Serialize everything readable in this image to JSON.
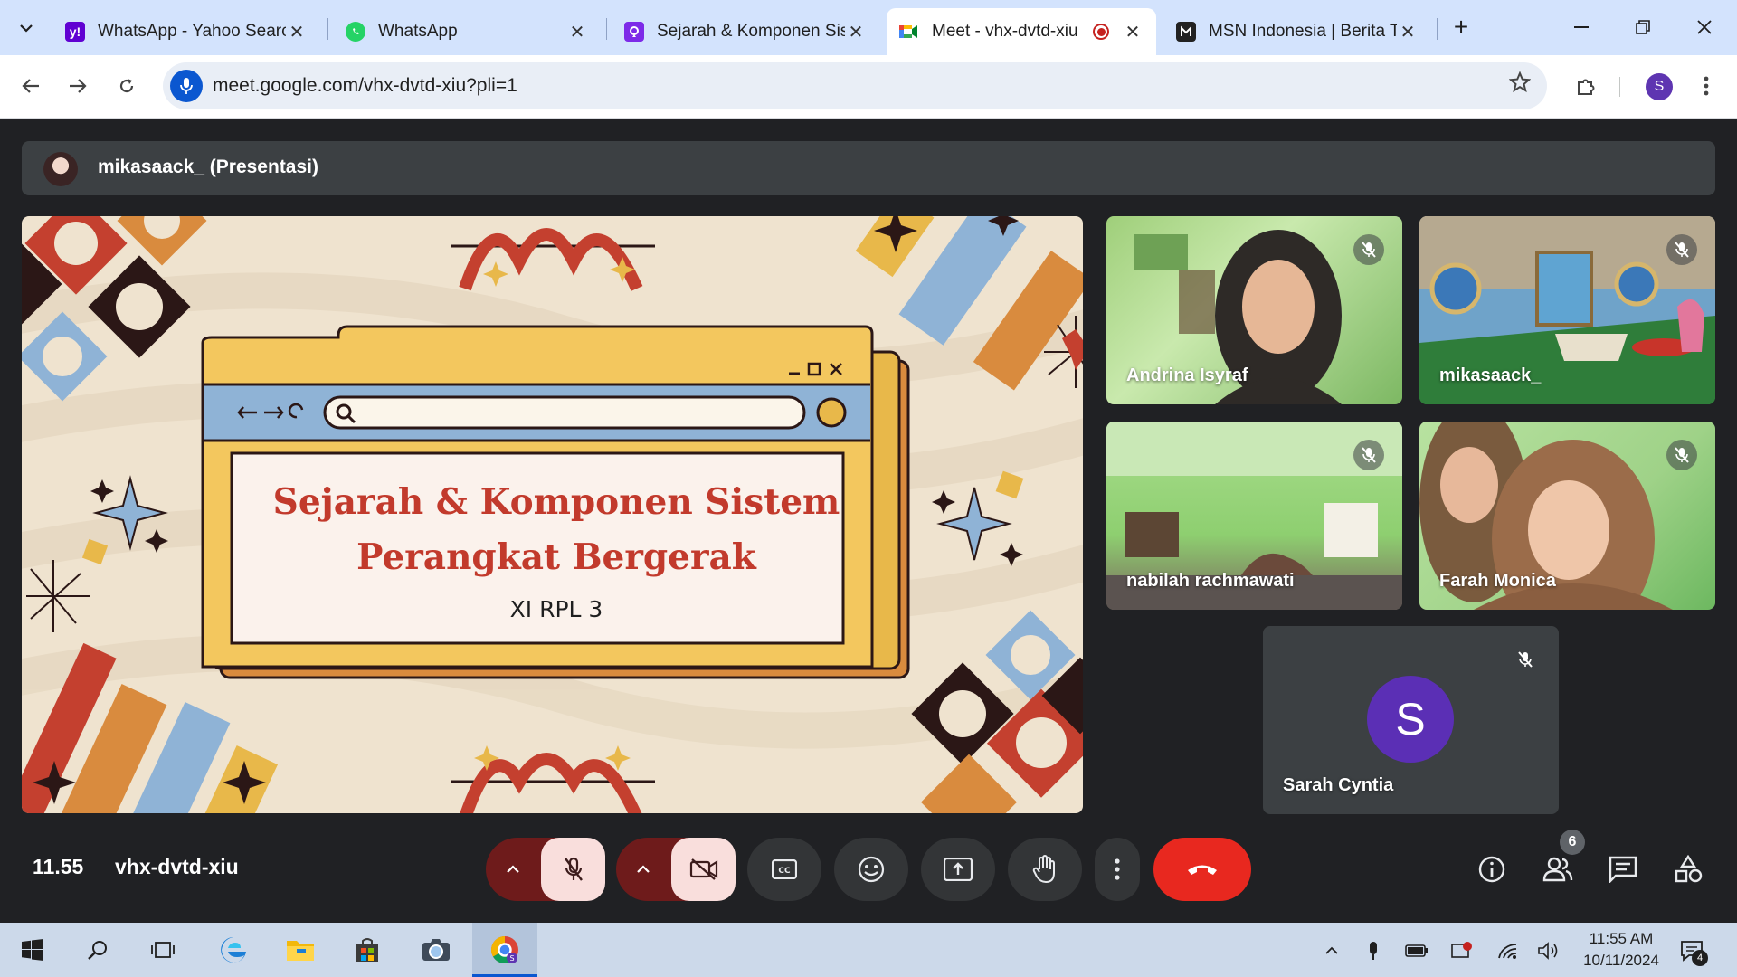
{
  "browser": {
    "tabs": [
      {
        "title": "WhatsApp - Yahoo Searc",
        "icon": "yahoo-icon",
        "close": "✕"
      },
      {
        "title": "WhatsApp",
        "icon": "whatsapp-icon",
        "close": "✕"
      },
      {
        "title": "Sejarah & Komponen Sist",
        "icon": "canva-icon",
        "close": "✕"
      },
      {
        "title": "Meet - vhx-dvtd-xiu",
        "icon": "google-meet-icon",
        "close": "✕",
        "active": true
      },
      {
        "title": "MSN Indonesia | Berita Te",
        "icon": "msn-icon",
        "close": "✕"
      }
    ],
    "new_tab": "+",
    "url": "meet.google.com/vhx-dvtd-xiu?pli=1",
    "profile_initial": "S",
    "window_controls": {
      "minimize": "—",
      "restore": "❐",
      "close": "✕"
    }
  },
  "meet": {
    "presenter_label": "mikasaack_ (Presentasi)",
    "slide": {
      "title_line1": "Sejarah & Komponen Sistem",
      "title_line2": "Perangkat Bergerak",
      "subtitle": "XI RPL 3"
    },
    "participants": [
      {
        "name": "Andrina Isyraf",
        "muted": true
      },
      {
        "name": "mikasaack_",
        "muted": true
      },
      {
        "name": "nabilah rachmawati",
        "muted": true
      },
      {
        "name": "Farah Monica",
        "muted": true
      },
      {
        "name": "Sarah Cyntia",
        "muted": true,
        "initial": "S"
      }
    ],
    "clock": "11.55",
    "meeting_code": "vhx-dvtd-xiu",
    "people_count": "6"
  },
  "taskbar": {
    "time": "11:55 AM",
    "date": "10/11/2024",
    "notification_count": "4"
  },
  "colors": {
    "tabbar": "#d3e3fd",
    "meet_bg": "#202124",
    "end_call": "#e8281f",
    "slide_title": "#c23a2c",
    "avatar_purple": "#5b2fb5"
  }
}
